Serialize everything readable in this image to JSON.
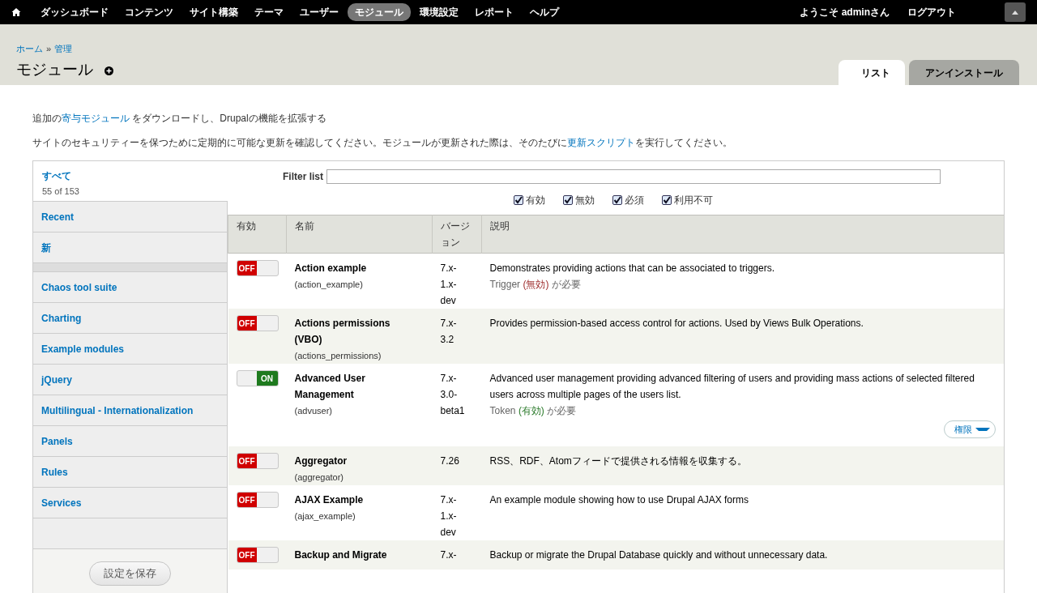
{
  "toolbar": {
    "items": [
      {
        "label": "ダッシュボード",
        "selected": false
      },
      {
        "label": "コンテンツ",
        "selected": false
      },
      {
        "label": "サイト構築",
        "selected": false
      },
      {
        "label": "テーマ",
        "selected": false
      },
      {
        "label": "ユーザー",
        "selected": false
      },
      {
        "label": "モジュール",
        "selected": true
      },
      {
        "label": "環境設定",
        "selected": false
      },
      {
        "label": "レポート",
        "selected": false
      },
      {
        "label": "ヘルプ",
        "selected": false
      }
    ],
    "welcome": "ようこそ **admin**さん",
    "logout": "ログアウト"
  },
  "breadcrumb": {
    "items": [
      "ホーム",
      "管理"
    ],
    "separator": "»"
  },
  "title": "モジュール",
  "tabs": [
    {
      "label": "リスト",
      "selected": true
    },
    {
      "label": "アンインストール",
      "selected": false
    }
  ],
  "intro": {
    "before": "追加の",
    "link": "寄与モジュール",
    "after": " をダウンロードし、Drupalの機能を拡張する"
  },
  "security": {
    "before": "サイトのセキュリティーを保つために定期的に可能な更新を確認してください。モジュールが更新された際は、そのたびに",
    "link": "更新スクリプト",
    "after": "を実行してください。"
  },
  "sidebar": {
    "all": "すべて",
    "count": "55 of 153",
    "categories": [
      {
        "kind": "item",
        "label": "Recent"
      },
      {
        "kind": "item",
        "label": "新"
      },
      {
        "kind": "gap"
      },
      {
        "kind": "item",
        "label": "Chaos tool suite"
      },
      {
        "kind": "item",
        "label": "Charting"
      },
      {
        "kind": "item",
        "label": "Example modules"
      },
      {
        "kind": "item",
        "label": "jQuery"
      },
      {
        "kind": "item",
        "label": "Multilingual - Internationalization"
      },
      {
        "kind": "item",
        "label": "Panels"
      },
      {
        "kind": "item",
        "label": "Rules"
      },
      {
        "kind": "item",
        "label": "Services"
      }
    ],
    "save_button": "設定を保存"
  },
  "filter": {
    "label": "Filter list",
    "checkboxes": [
      {
        "label": "有効",
        "checked": true
      },
      {
        "label": "無効",
        "checked": true
      },
      {
        "label": "必須",
        "checked": true
      },
      {
        "label": "利用不可",
        "checked": true
      }
    ]
  },
  "table": {
    "columns": [
      "有効",
      "名前",
      "バージョン",
      "説明"
    ],
    "rows": [
      {
        "enabled": false,
        "toggle_label": "OFF",
        "name": "Action example",
        "machine_name": "(action_example)",
        "version": "7.x-1.x-dev",
        "description": "Demonstrates providing actions that can be associated to triggers.",
        "requires": {
          "module": "Trigger",
          "status": "(無効)",
          "status_ok": false,
          "suffix": "が必要"
        }
      },
      {
        "enabled": false,
        "toggle_label": "OFF",
        "name": "Actions permissions (VBO)",
        "machine_name": "(actions_permissions)",
        "version": "7.x-3.2",
        "description": "Provides permission-based access control for actions. Used by Views Bulk Operations."
      },
      {
        "enabled": true,
        "toggle_label": "ON",
        "name": "Advanced User Management",
        "machine_name": "(advuser)",
        "version": "7.x-3.0-beta1",
        "description": "Advanced user management providing advanced filtering of users and providing mass actions of selected filtered users across multiple pages of the users list.",
        "requires": {
          "module": "Token",
          "status": "(有効)",
          "status_ok": true,
          "suffix": "が必要"
        },
        "action": "権限"
      },
      {
        "enabled": false,
        "toggle_label": "OFF",
        "name": "Aggregator",
        "machine_name": "(aggregator)",
        "version": "7.26",
        "description": "RSS、RDF、Atomフィードで提供される情報を収集する。"
      },
      {
        "enabled": false,
        "toggle_label": "OFF",
        "name": "AJAX Example",
        "machine_name": "(ajax_example)",
        "version": "7.x-1.x-dev",
        "description": "An example module showing how to use Drupal AJAX forms"
      },
      {
        "enabled": false,
        "toggle_label": "OFF",
        "name": "Backup and Migrate",
        "version": "7.x-",
        "description": "Backup or migrate the Drupal Database quickly and without unnecessary data."
      }
    ]
  }
}
